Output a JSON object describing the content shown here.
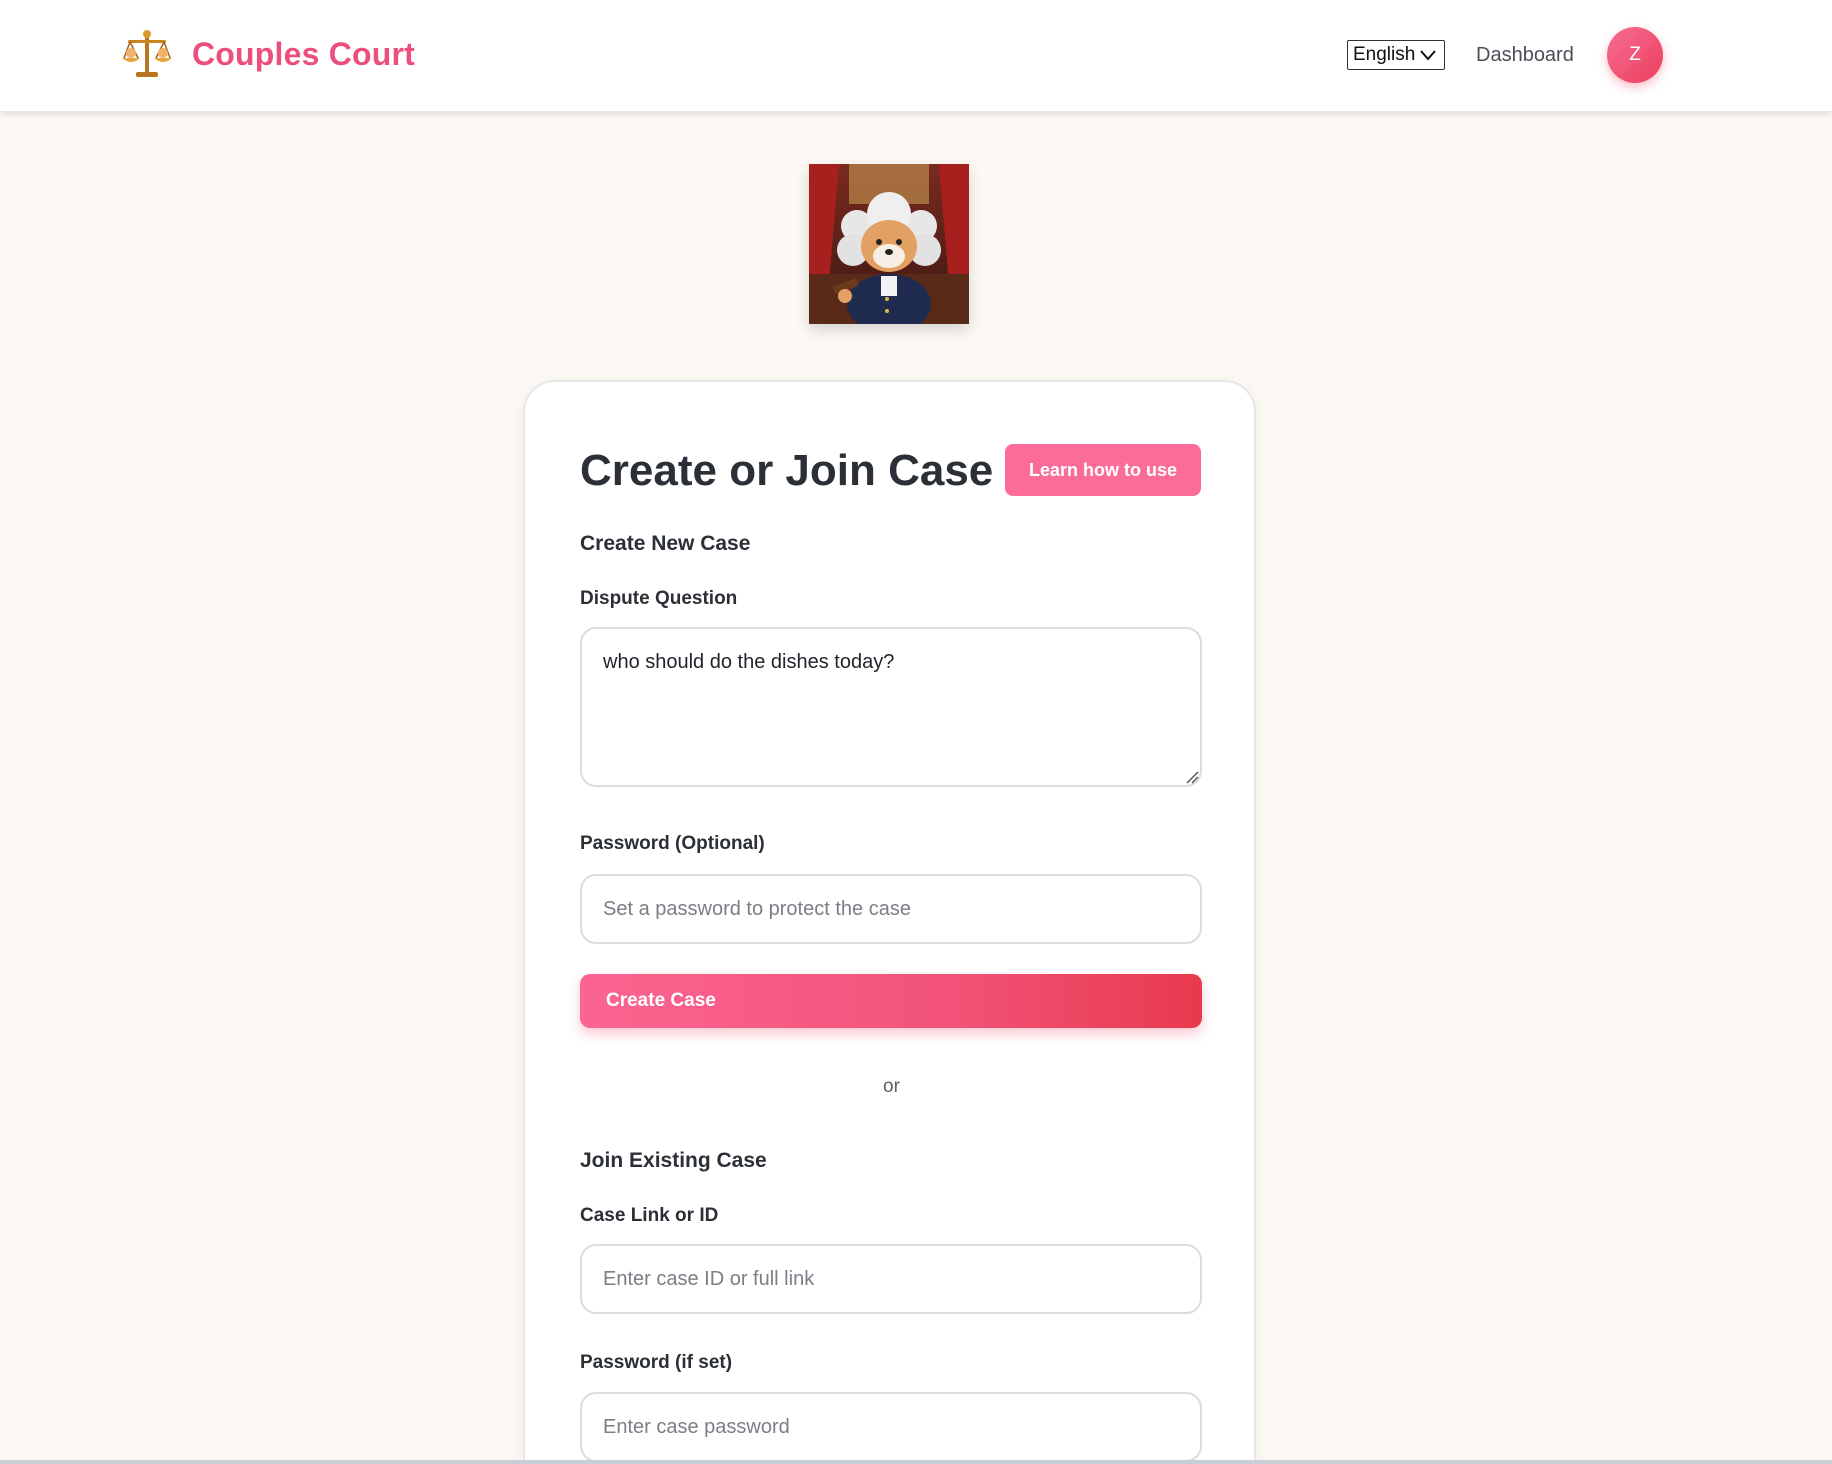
{
  "header": {
    "brand": "Couples Court",
    "language": "English",
    "nav_dashboard": "Dashboard",
    "avatar_initial": "Z"
  },
  "card": {
    "title": "Create or Join Case",
    "learn_button": "Learn how to use",
    "create_section": {
      "title": "Create New Case",
      "dispute_label": "Dispute Question",
      "dispute_value": "who should do the dishes today?",
      "password_label": "Password (Optional)",
      "password_placeholder": "Set a password to protect the case",
      "create_button": "Create Case"
    },
    "divider": "or",
    "join_section": {
      "title": "Join Existing Case",
      "case_label": "Case Link or ID",
      "case_placeholder": "Enter case ID or full link",
      "password_label": "Password (if set)",
      "password_placeholder": "Enter case password"
    }
  },
  "colors": {
    "brand": "#ec4f7c",
    "accent": "#fb6c98",
    "button_gradient_end": "#e83a4e",
    "background": "#fcf8f4"
  },
  "icons": [
    "scales-logo-icon",
    "chevron-down-icon",
    "judge-dog-mascot"
  ]
}
